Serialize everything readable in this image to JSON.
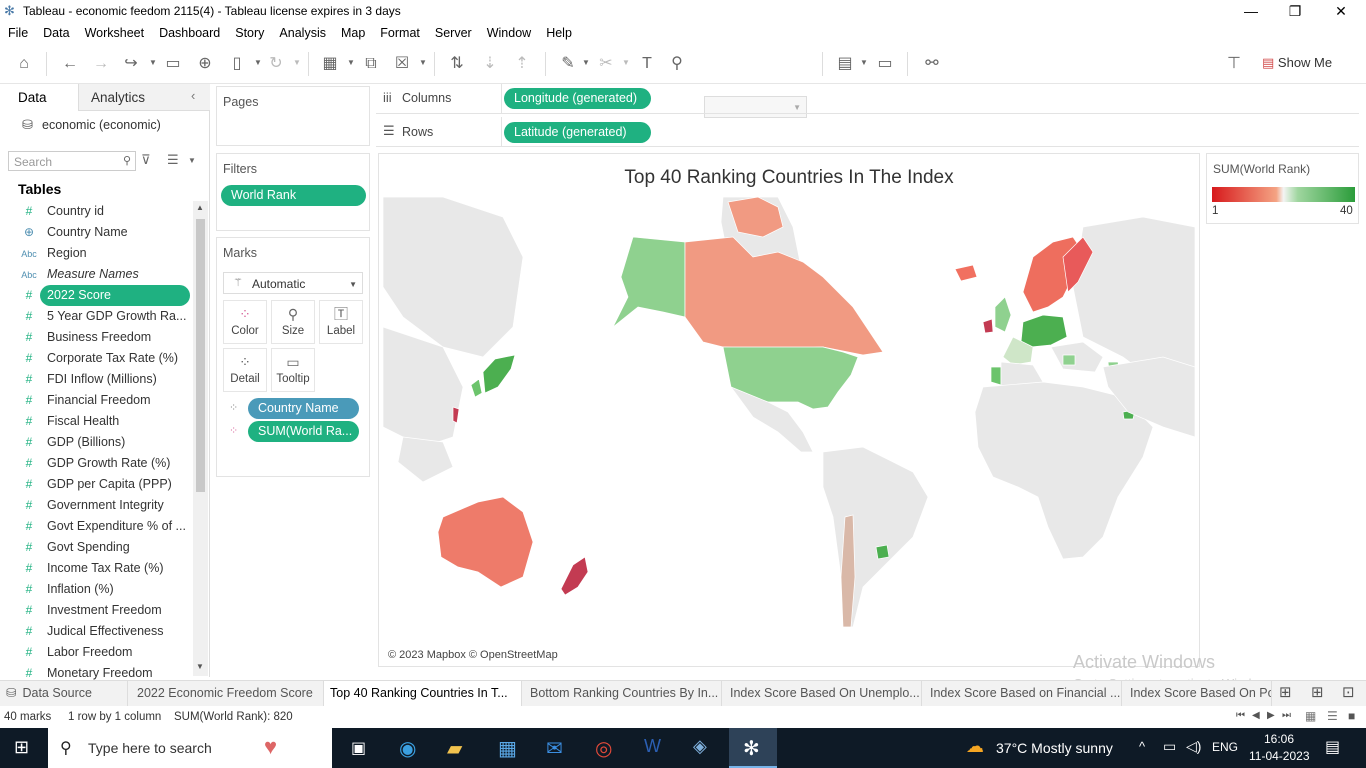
{
  "window": {
    "title": "Tableau - economic feedom 2115(4) - Tableau license expires in 3 days"
  },
  "menu": [
    "File",
    "Data",
    "Worksheet",
    "Dashboard",
    "Story",
    "Analysis",
    "Map",
    "Format",
    "Server",
    "Window",
    "Help"
  ],
  "toolbar": {
    "show_me_label": "Show Me"
  },
  "left_pane": {
    "tab_data": "Data",
    "tab_analytics": "Analytics",
    "datasource": "economic (economic)",
    "search_placeholder": "Search",
    "tables_heading": "Tables",
    "fields": [
      {
        "icon": "#",
        "label": "Country id"
      },
      {
        "icon": "globe",
        "label": "Country Name"
      },
      {
        "icon": "Abc",
        "label": "Region"
      },
      {
        "icon": "Abc",
        "label": "Measure Names"
      },
      {
        "icon": "#",
        "label": "2022 Score"
      },
      {
        "icon": "#",
        "label": "5 Year GDP Growth Ra..."
      },
      {
        "icon": "#",
        "label": "Business Freedom"
      },
      {
        "icon": "#",
        "label": "Corporate Tax Rate (%)"
      },
      {
        "icon": "#",
        "label": "FDI Inflow (Millions)"
      },
      {
        "icon": "#",
        "label": "Financial Freedom"
      },
      {
        "icon": "#",
        "label": "Fiscal Health"
      },
      {
        "icon": "#",
        "label": "GDP (Billions)"
      },
      {
        "icon": "#",
        "label": "GDP Growth Rate (%)"
      },
      {
        "icon": "#",
        "label": "GDP per Capita (PPP)"
      },
      {
        "icon": "#",
        "label": "Government Integrity"
      },
      {
        "icon": "#",
        "label": "Govt Expenditure % of ..."
      },
      {
        "icon": "#",
        "label": "Govt Spending"
      },
      {
        "icon": "#",
        "label": "Income Tax Rate (%)"
      },
      {
        "icon": "#",
        "label": "Inflation (%)"
      },
      {
        "icon": "#",
        "label": "Investment Freedom"
      },
      {
        "icon": "#",
        "label": "Judical Effectiveness"
      },
      {
        "icon": "#",
        "label": "Labor Freedom"
      },
      {
        "icon": "#",
        "label": "Monetary Freedom"
      }
    ]
  },
  "shelves": {
    "pages": "Pages",
    "filters": "Filters",
    "filter_pill": "World Rank",
    "marks": "Marks",
    "mark_type": "Automatic",
    "mark_buttons": [
      "Color",
      "Size",
      "Label",
      "Detail",
      "Tooltip"
    ],
    "mark_pills": [
      "Country Name",
      "SUM(World Ra..."
    ],
    "columns_label": "Columns",
    "columns_pill": "Longitude (generated)",
    "rows_label": "Rows",
    "rows_pill": "Latitude (generated)"
  },
  "view": {
    "title": "Top 40 Ranking Countries In The Index",
    "attribution": "© 2023 Mapbox © OpenStreetMap",
    "watermark_1": "Activate Windows",
    "watermark_2": "Go to Settings to activate Windows."
  },
  "legend": {
    "title": "SUM(World Rank)",
    "min": "1",
    "max": "40",
    "low_color": "#d7191c",
    "mid_color": "#f4f4f4",
    "high_color": "#2b9c3a"
  },
  "sheet_tabs": [
    "Data Source",
    "2022 Economic Freedom Score",
    "Top 40 Ranking Countries In T...",
    "Bottom Ranking Countries By In...",
    "Index Score Based On Unemplo...",
    "Index Score Based on Financial ...",
    "Index Score Based On Po"
  ],
  "status": {
    "marks": "40 marks",
    "rows_cols": "1 row by 1 column",
    "sum": "SUM(World Rank): 820"
  },
  "taskbar": {
    "search_placeholder": "Type here to search",
    "weather": "37°C  Mostly sunny",
    "lang": "ENG",
    "time": "16:06",
    "date": "11-04-2023"
  }
}
